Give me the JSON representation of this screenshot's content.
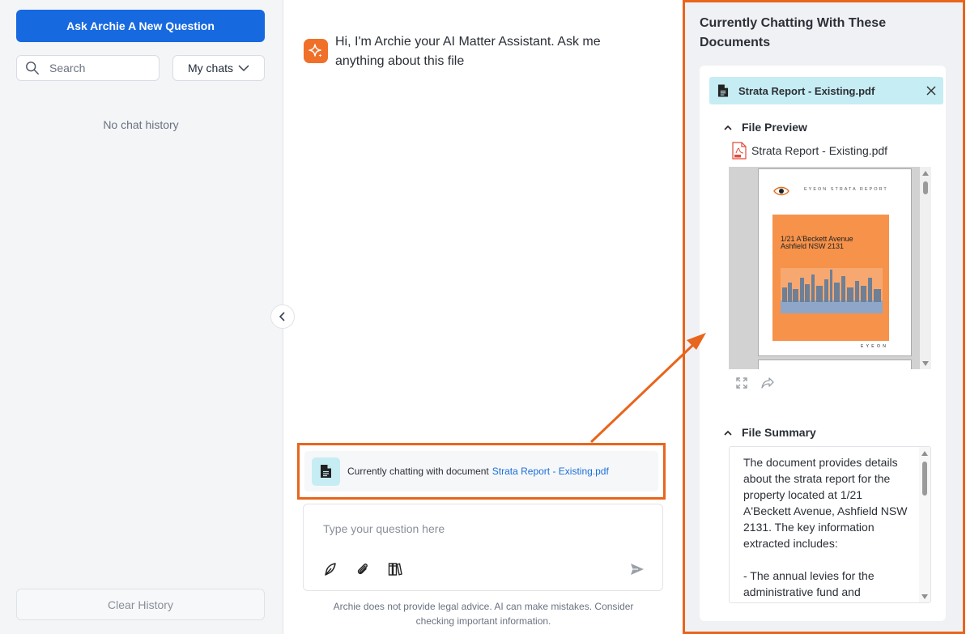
{
  "sidebar": {
    "ask_button": "Ask Archie A New Question",
    "search_placeholder": "Search",
    "filter_label": "My chats",
    "empty_text": "No chat history",
    "clear_button": "Clear History"
  },
  "chat": {
    "greeting": "Hi, I'm Archie your AI Matter Assistant. Ask me anything about this file",
    "banner_text": "Currently chatting with document",
    "banner_doc": "Strata Report - Existing.pdf",
    "input_placeholder": "Type your question here",
    "disclaimer": "Archie does not provide legal advice. AI can make mistakes. Consider checking important information."
  },
  "panel": {
    "title": "Currently Chatting With These Documents",
    "file_name": "Strata Report - Existing.pdf",
    "file_preview_heading": "File Preview",
    "preview_file_name": "Strata Report - Existing.pdf",
    "preview_page": {
      "brand": "EYEON STRATA REPORT",
      "address_line1": "1/21 A'Beckett Avenue",
      "address_line2": "Ashfield NSW 2131"
    },
    "file_summary_heading": "File Summary",
    "summary": "The document provides details about the strata report for the property located at 1/21 A'Beckett Avenue, Ashfield NSW 2131. The key information extracted includes:\n\n- The annual levies for the administrative fund and"
  },
  "icons": {
    "search": "search-icon",
    "chevron": "chevron-down-icon",
    "collapse": "chevron-left-icon",
    "assistant": "sparkle-icon",
    "document": "document-icon",
    "pen": "pen-icon",
    "attach": "paperclip-icon",
    "library": "library-icon",
    "send": "send-icon",
    "close": "close-icon",
    "pdf": "pdf-file-icon",
    "expand": "expand-icon",
    "share": "share-icon"
  },
  "colors": {
    "primary": "#1769e0",
    "highlight": "#e8651c",
    "chip": "#c6edf3",
    "assistant": "#f0702a",
    "link": "#1a6fd8"
  }
}
